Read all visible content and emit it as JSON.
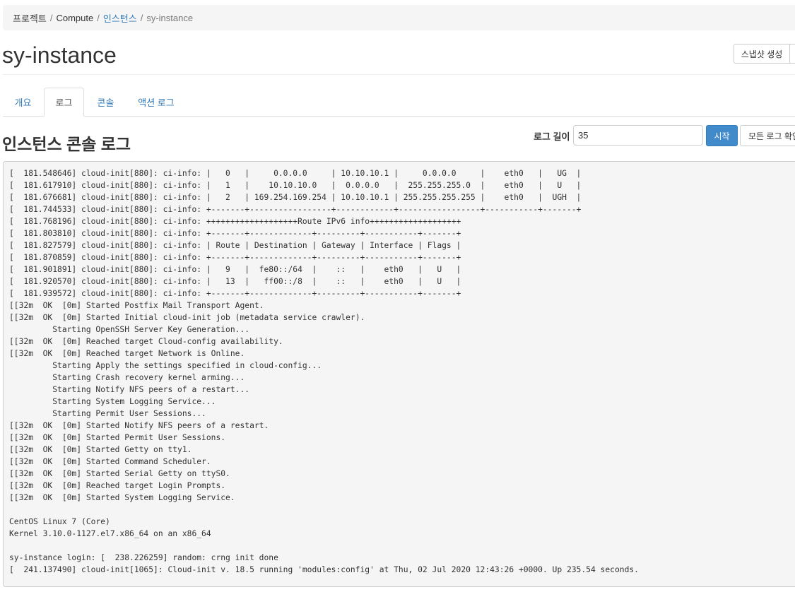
{
  "breadcrumb": {
    "items": [
      {
        "label": "프로젝트"
      },
      {
        "label": "Compute"
      },
      {
        "label": "인스턴스"
      },
      {
        "label": "sy-instance"
      }
    ],
    "separator": "/"
  },
  "header": {
    "title": "sy-instance",
    "snapshot_button": "스냅샷 생성"
  },
  "tabs": [
    {
      "label": "개요",
      "active": false
    },
    {
      "label": "로그",
      "active": true
    },
    {
      "label": "콘솔",
      "active": false
    },
    {
      "label": "액션 로그",
      "active": false
    }
  ],
  "log_section": {
    "title": "인스턴스 콘솔 로그",
    "length_label": "로그 길이",
    "length_value": "35",
    "start_button": "시작",
    "view_all_button": "모든 로그 확인"
  },
  "log_lines": [
    "[  181.548646] cloud-init[880]: ci-info: |   0   |     0.0.0.0     | 10.10.10.1 |     0.0.0.0     |    eth0   |   UG  |",
    "[  181.617910] cloud-init[880]: ci-info: |   1   |    10.10.10.0   |  0.0.0.0   |  255.255.255.0  |    eth0   |   U   |",
    "[  181.676681] cloud-init[880]: ci-info: |   2   | 169.254.169.254 | 10.10.10.1 | 255.255.255.255 |    eth0   |  UGH  |",
    "[  181.744533] cloud-init[880]: ci-info: +-------+-----------------+------------+-----------------+-----------+-------+",
    "[  181.768196] cloud-init[880]: ci-info: +++++++++++++++++++Route IPv6 info+++++++++++++++++++",
    "[  181.803810] cloud-init[880]: ci-info: +-------+-------------+---------+-----------+-------+",
    "[  181.827579] cloud-init[880]: ci-info: | Route | Destination | Gateway | Interface | Flags |",
    "[  181.870859] cloud-init[880]: ci-info: +-------+-------------+---------+-----------+-------+",
    "[  181.901891] cloud-init[880]: ci-info: |   9   |  fe80::/64  |    ::   |    eth0   |   U   |",
    "[  181.920570] cloud-init[880]: ci-info: |   13  |   ff00::/8  |    ::   |    eth0   |   U   |",
    "[  181.939572] cloud-init[880]: ci-info: +-------+-------------+---------+-----------+-------+",
    "[[32m  OK  [0m] Started Postfix Mail Transport Agent.",
    "[[32m  OK  [0m] Started Initial cloud-init job (metadata service crawler).",
    "         Starting OpenSSH Server Key Generation...",
    "[[32m  OK  [0m] Reached target Cloud-config availability.",
    "[[32m  OK  [0m] Reached target Network is Online.",
    "         Starting Apply the settings specified in cloud-config...",
    "         Starting Crash recovery kernel arming...",
    "         Starting Notify NFS peers of a restart...",
    "         Starting System Logging Service...",
    "         Starting Permit User Sessions...",
    "[[32m  OK  [0m] Started Notify NFS peers of a restart.",
    "[[32m  OK  [0m] Started Permit User Sessions.",
    "[[32m  OK  [0m] Started Getty on tty1.",
    "[[32m  OK  [0m] Started Command Scheduler.",
    "[[32m  OK  [0m] Started Serial Getty on ttyS0.",
    "[[32m  OK  [0m] Reached target Login Prompts.",
    "[[32m  OK  [0m] Started System Logging Service.",
    "",
    "CentOS Linux 7 (Core)",
    "Kernel 3.10.0-1127.el7.x86_64 on an x86_64",
    "",
    "sy-instance login: [  238.226259] random: crng init done",
    "[  241.137490] cloud-init[1065]: Cloud-init v. 18.5 running 'modules:config' at Thu, 02 Jul 2020 12:43:26 +0000. Up 235.54 seconds."
  ]
}
